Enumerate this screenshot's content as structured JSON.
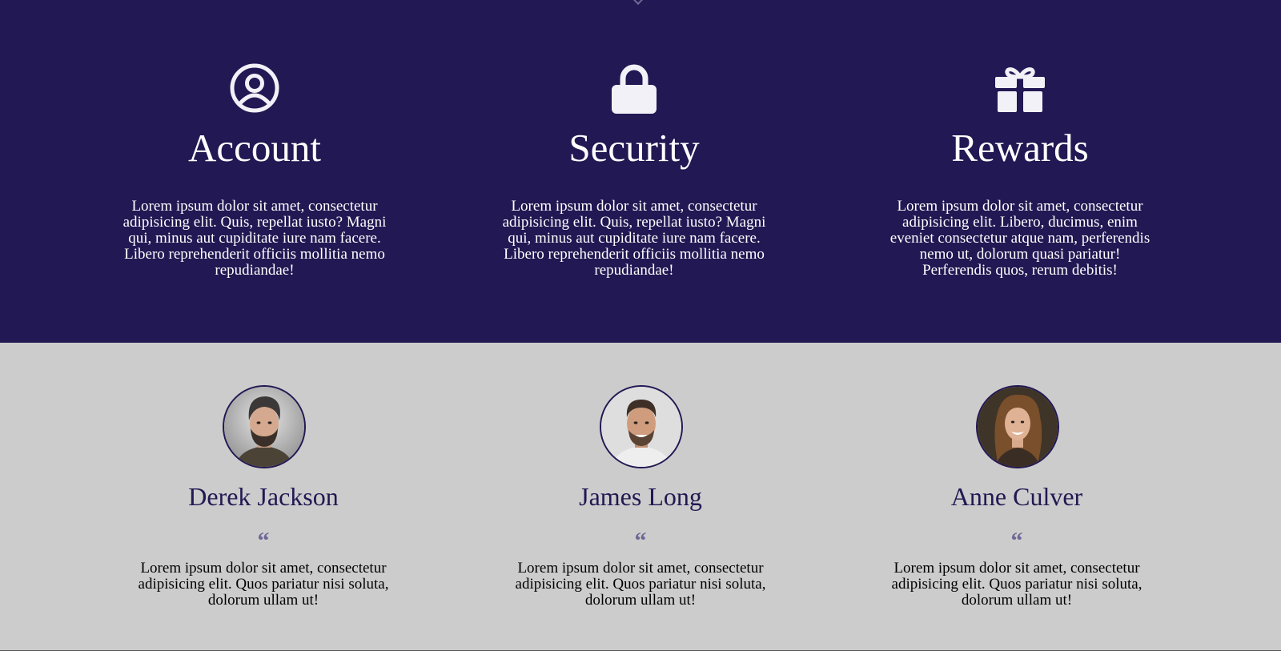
{
  "features": [
    {
      "icon": "user-circle-icon",
      "title": "Account",
      "text": "Lorem ipsum dolor sit amet, consectetur adipisicing elit. Quis, repellat iusto? Magni qui, minus aut cupiditate iure nam facere. Libero reprehenderit officiis mollitia nemo repudiandae!"
    },
    {
      "icon": "lock-icon",
      "title": "Security",
      "text": "Lorem ipsum dolor sit amet, consectetur adipisicing elit. Quis, repellat iusto? Magni qui, minus aut cupiditate iure nam facere. Libero reprehenderit officiis mollitia nemo repudiandae!"
    },
    {
      "icon": "gift-icon",
      "title": "Rewards",
      "text": "Lorem ipsum dolor sit amet, consectetur adipisicing elit. Libero, ducimus, enim eveniet consectetur atque nam, perferendis nemo ut, dolorum quasi pariatur! Perferendis quos, rerum debitis!"
    }
  ],
  "testimonials": [
    {
      "name": "Derek Jackson",
      "quote_mark": "“",
      "text": "Lorem ipsum dolor sit amet, consectetur adipisicing elit. Quos pariatur nisi soluta, dolorum ullam ut!"
    },
    {
      "name": "James Long",
      "quote_mark": "“",
      "text": "Lorem ipsum dolor sit amet, consectetur adipisicing elit. Quos pariatur nisi soluta, dolorum ullam ut!"
    },
    {
      "name": "Anne Culver",
      "quote_mark": "“",
      "text": "Lorem ipsum dolor sit amet, consectetur adipisicing elit. Quos pariatur nisi soluta, dolorum ullam ut!"
    }
  ],
  "colors": {
    "features_background": "#221853",
    "testimonials_background": "#cccccc",
    "accent": "#221853",
    "quote_mark": "#6e6896"
  }
}
